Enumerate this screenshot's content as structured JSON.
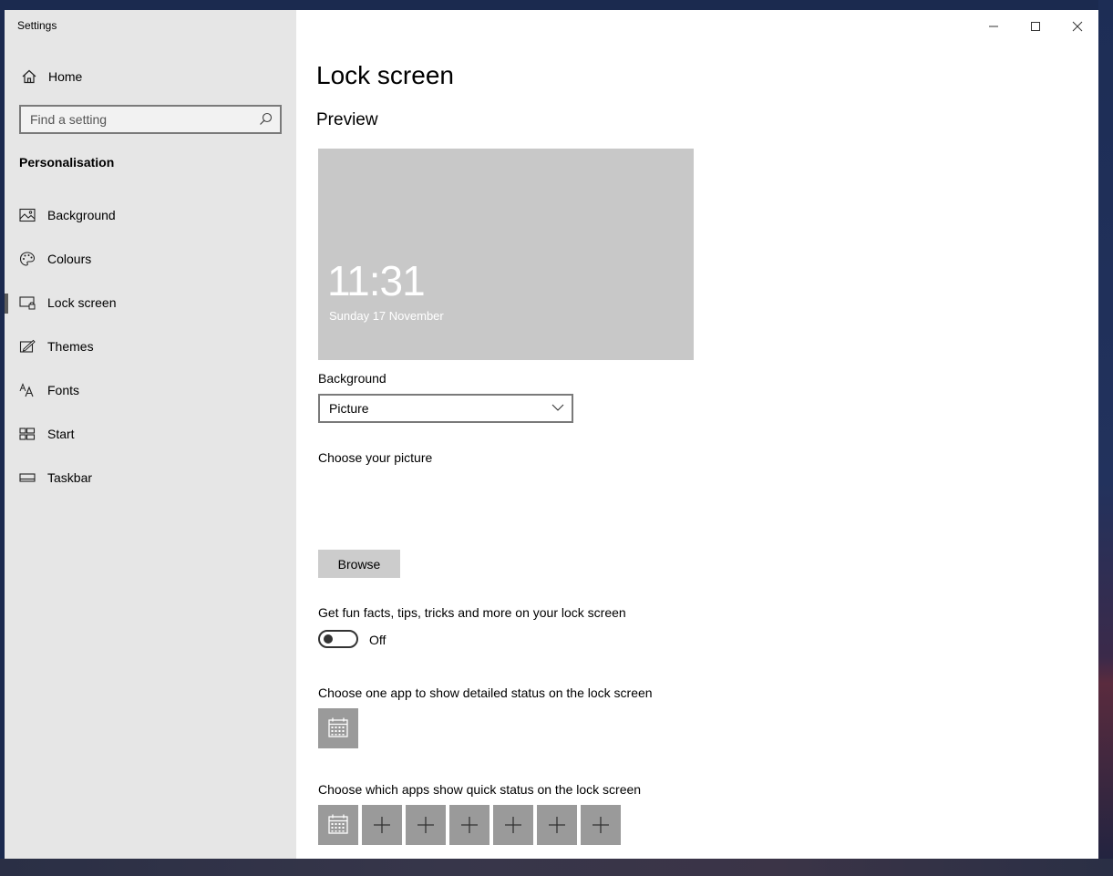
{
  "window": {
    "title": "Settings",
    "accent": "#5a5a5a"
  },
  "sidebar": {
    "home_label": "Home",
    "search_placeholder": "Find a setting",
    "section": "Personalisation",
    "items": [
      {
        "label": "Background",
        "icon": "picture-icon"
      },
      {
        "label": "Colours",
        "icon": "palette-icon"
      },
      {
        "label": "Lock screen",
        "icon": "lock-screen-icon",
        "active": true
      },
      {
        "label": "Themes",
        "icon": "themes-icon"
      },
      {
        "label": "Fonts",
        "icon": "fonts-icon"
      },
      {
        "label": "Start",
        "icon": "start-icon"
      },
      {
        "label": "Taskbar",
        "icon": "taskbar-icon"
      }
    ]
  },
  "main": {
    "title": "Lock screen",
    "preview_heading": "Preview",
    "preview": {
      "time": "11:31",
      "date": "Sunday 17 November"
    },
    "background_label": "Background",
    "background_value": "Picture",
    "choose_picture_label": "Choose your picture",
    "browse_label": "Browse",
    "fun_facts_label": "Get fun facts, tips, tricks and more on your lock screen",
    "fun_facts_state": "Off",
    "detailed_status_label": "Choose one app to show detailed status on the lock screen",
    "quick_status_label": "Choose which apps show quick status on the lock screen",
    "quick_status_tiles": [
      "calendar-icon",
      "plus-icon",
      "plus-icon",
      "plus-icon",
      "plus-icon",
      "plus-icon",
      "plus-icon"
    ]
  }
}
